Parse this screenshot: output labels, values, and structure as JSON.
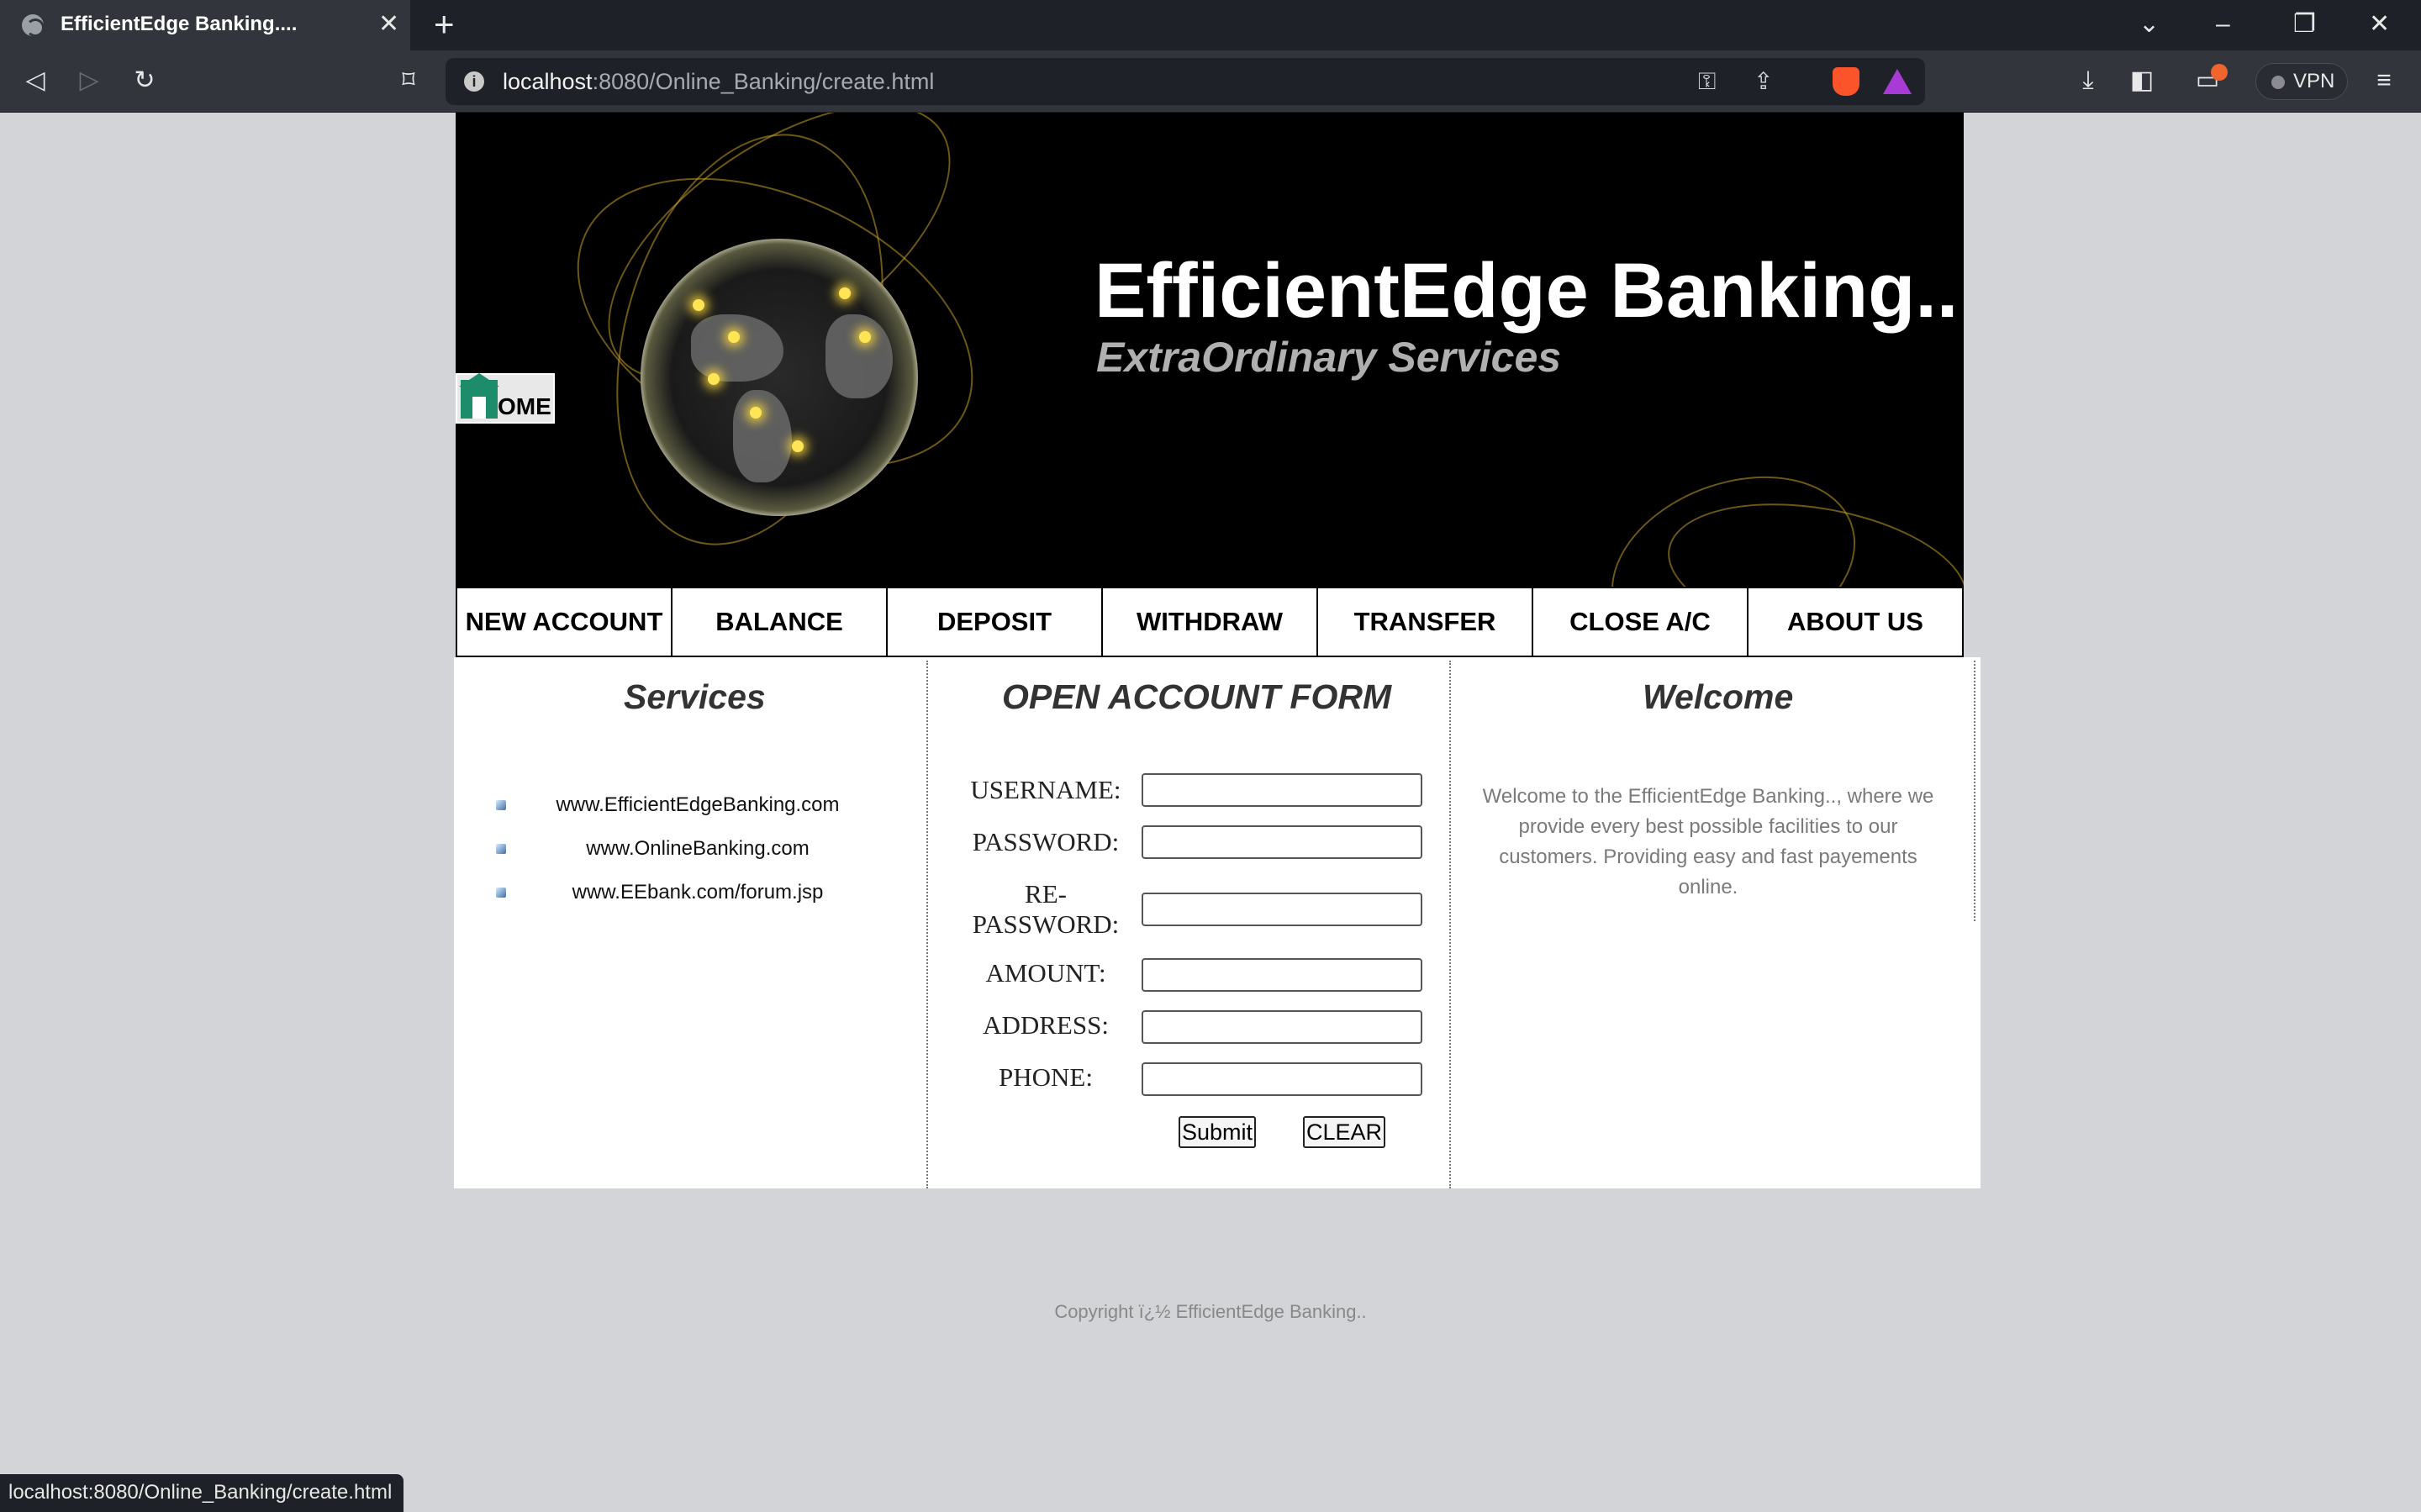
{
  "browser": {
    "tab_title": "EfficientEdge Banking....",
    "tab_close": "✕",
    "new_tab": "+",
    "url_host": "localhost",
    "url_rest": ":8080/Online_Banking/create.html",
    "vpn_label": "VPN",
    "status_url": "localhost:8080/Online_Banking/create.html",
    "icons": [
      "globe-icon",
      "back-icon",
      "forward-icon",
      "reload-icon",
      "bookmark-icon",
      "key-icon",
      "share-icon",
      "brave-shield-icon",
      "rewards-icon",
      "download-icon",
      "sidebar-icon",
      "wallet-icon",
      "menu-icon"
    ]
  },
  "header": {
    "bank_name": "EfficientEdge Banking..",
    "tagline": "ExtraOrdinary Services",
    "home_text": "OME"
  },
  "nav": {
    "items": [
      "NEW ACCOUNT",
      "BALANCE",
      "DEPOSIT",
      "WITHDRAW",
      "TRANSFER",
      "CLOSE A/C",
      "ABOUT US"
    ]
  },
  "services": {
    "title": "Services",
    "links": [
      "www.EfficientEdgeBanking.com",
      "www.OnlineBanking.com",
      "www.EEbank.com/forum.jsp"
    ]
  },
  "form": {
    "title": "OPEN ACCOUNT FORM",
    "labels": {
      "username": "USERNAME:",
      "password": "PASSWORD:",
      "repassword": "RE-PASSWORD:",
      "amount": "AMOUNT:",
      "address": "ADDRESS:",
      "phone": "PHONE:"
    },
    "submit": "Submit",
    "clear": "CLEAR"
  },
  "welcome": {
    "title": "Welcome",
    "text": "Welcome to the EfficientEdge Banking.., where we provide every best possible facilities to our customers. Providing easy and fast payements online."
  },
  "footer": {
    "copyright": "Copyright ï¿½ EfficientEdge Banking.."
  }
}
